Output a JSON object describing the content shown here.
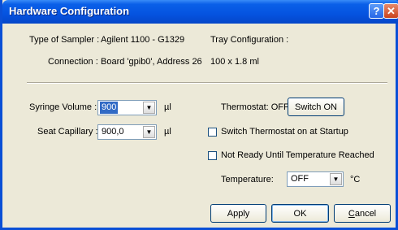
{
  "window": {
    "title": "Hardware Configuration",
    "help_glyph": "?",
    "close_glyph": "✕"
  },
  "info": {
    "sampler_label": "Type of Sampler :",
    "sampler_value": "Agilent 1100 - G1329",
    "connection_label": "Connection :",
    "connection_value": "Board 'gpib0', Address 26",
    "tray_label": "Tray Configuration :",
    "tray_value": "100 x 1.8 ml"
  },
  "syringe": {
    "label": "Syringe Volume :",
    "value": "900",
    "unit": "µl"
  },
  "seat": {
    "label": "Seat Capillary :",
    "value": "900,0",
    "unit": "µl"
  },
  "thermostat": {
    "status": "Thermostat: OFF",
    "switch_label": "Switch ON",
    "startup_label": "Switch Thermostat on at Startup",
    "startup_checked": false,
    "notready_label": "Not Ready Until Temperature Reached",
    "notready_checked": false,
    "temperature_label": "Temperature:",
    "temperature_value": "OFF",
    "temperature_unit": "°C"
  },
  "buttons": {
    "apply": "Apply",
    "ok": "OK",
    "cancel_first": "C",
    "cancel_rest": "ancel"
  },
  "icons": {
    "dropdown": "dropdown-arrow-icon",
    "help": "help-icon",
    "close": "close-icon"
  }
}
